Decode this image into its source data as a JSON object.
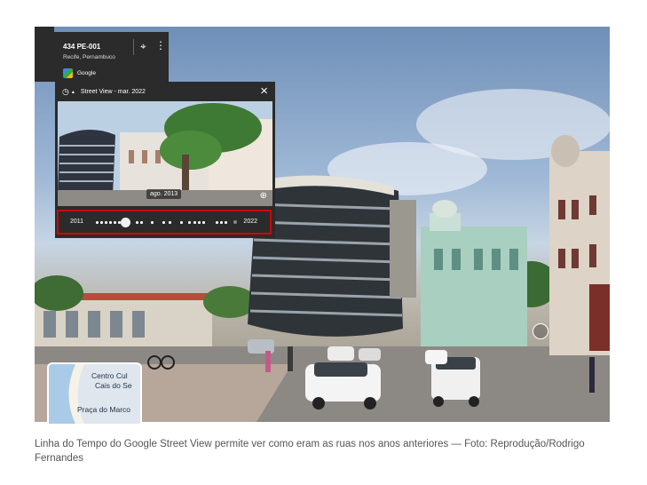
{
  "address_card": {
    "title": "434 PE-001",
    "subtitle": "Recife, Pernambuco",
    "provider": "Google",
    "back_icon": "arrow-left-icon",
    "pin_icon": "map-pin-icon",
    "more_icon": "more-vertical-icon"
  },
  "timeline": {
    "header": "Street View - mar. 2022",
    "thumbnail_date": "ago. 2013",
    "year_start": "2011",
    "year_end": "2022",
    "history_icon": "history-icon",
    "close_icon": "close-icon",
    "zoom_icon": "zoom-in-icon",
    "highlight_color": "#d40000"
  },
  "minimap": {
    "labels": [
      "Centro Cul",
      "Cais do Se",
      "Praça do Marco"
    ]
  },
  "caption": "Linha do Tempo do Google Street View permite ver como eram as ruas nos anos anteriores — Foto: Reprodução/Rodrigo Fernandes"
}
